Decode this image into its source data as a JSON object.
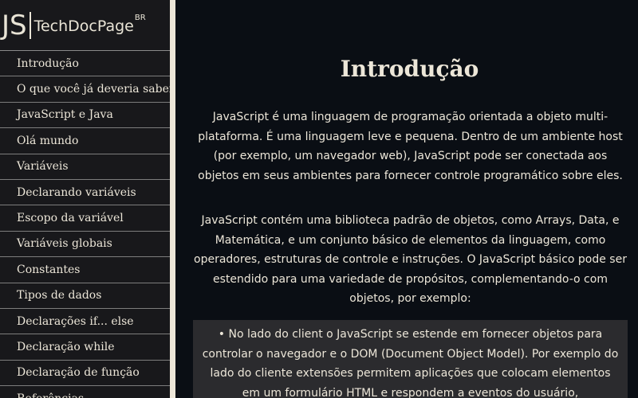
{
  "logo": {
    "js": "JS",
    "name": "TechDocPage",
    "sup": "BR"
  },
  "sidebar": {
    "items": [
      "Introdução",
      "O que você já deveria saber",
      "JavaScript e Java",
      "Olá mundo",
      "Variáveis",
      "Declarando variáveis",
      "Escopo da variável",
      "Variáveis globais",
      "Constantes",
      "Tipos de dados",
      "Declarações if... else",
      "Declaração while",
      "Declaração de função",
      "Referências"
    ]
  },
  "main": {
    "title": "Introdução",
    "paragraphs": [
      "JavaScript é uma linguagem de programação orientada a objeto multi-plataforma. É uma linguagem leve e pequena. Dentro de um ambiente host (por exemplo, um navegador web), JavaScript pode ser conectada aos objetos em seus ambientes para fornecer controle programático sobre eles.",
      "JavaScript contém uma biblioteca padrão de objetos, como Arrays, Data, e Matemática, e um conjunto básico de elementos da linguagem, como operadores, estruturas de controle e instruções. O JavaScript básico pode ser estendido para uma variedade de propósitos, complementando-o com objetos, por exemplo:"
    ],
    "note": "• No lado do client o JavaScript se estende em fornecer objetos para controlar o navegador e o DOM (Document Object Model). Por exemplo do lado do cliente extensões permitem aplicações que colocam elementos em um formulário HTML e respondem a eventos do usuário,"
  },
  "colors": {
    "background": "#0a0e14",
    "sidebar": "#18181b",
    "sidebar_border": "#ece6d8",
    "text": "#ece6d8",
    "note_background": "#2b2b2e"
  }
}
